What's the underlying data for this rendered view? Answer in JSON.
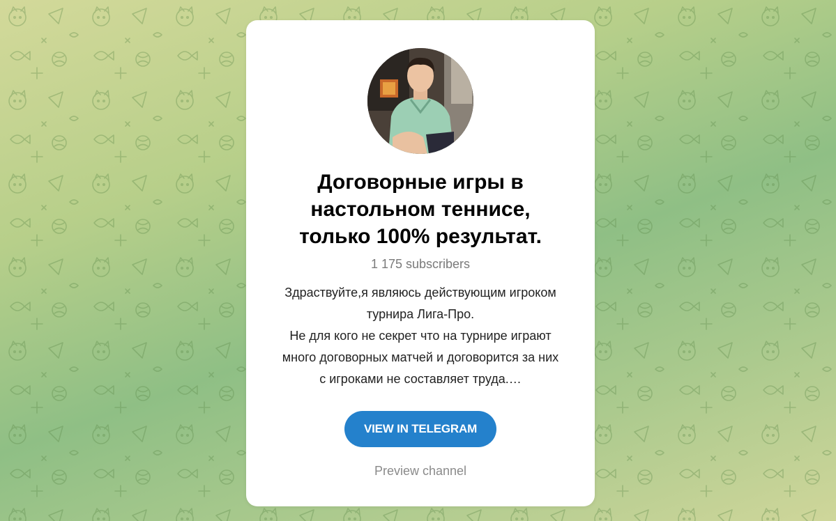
{
  "channel": {
    "title": "Договорные игры в\nнастольном теннисе,\nтолько 100% результат.",
    "subscribers": "1 175 subscribers",
    "description": "Здраствуйте,я являюсь действующим игроком\nтурнира Лига-Про.\nНе для кого не секрет что на турнире играют\nмного договорных матчей и договорится за них\nс игроками не составляет труда.…",
    "avatar_icon": "channel-avatar-photo"
  },
  "actions": {
    "view_label": "VIEW IN TELEGRAM",
    "preview_label": "Preview channel"
  },
  "colors": {
    "button": "#2481cc",
    "background_start": "#d3d99a",
    "background_mid": "#8fbf85",
    "muted_text": "#7a7a7a"
  }
}
